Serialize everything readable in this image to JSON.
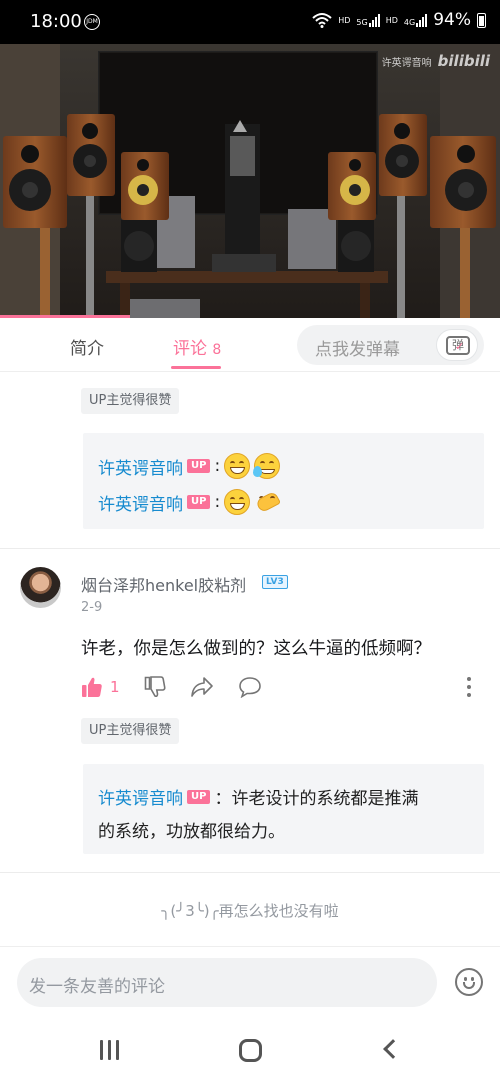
{
  "status_bar": {
    "time": "18:00",
    "notif_icon_label": "JDM",
    "hd1": "HD",
    "net5g": "5G",
    "hd2": "HD",
    "net4g": "4G",
    "battery": "94%"
  },
  "video": {
    "watermark_user": "许英谔音响",
    "watermark_logo": "bilibili",
    "progress_fraction": 0.26
  },
  "tabs": {
    "intro_label": "简介",
    "comments_label": "评论",
    "comments_count": "8",
    "danmaku_placeholder": "点我发弹幕",
    "danmaku_button_label": "弹"
  },
  "comments": [
    {
      "liked_tag": "UP主觉得很赞",
      "replies": [
        {
          "name": "许英谔音响",
          "badge": "UP",
          "sep": ":",
          "emojis": [
            "grin-emoji",
            "cry-emoji"
          ]
        },
        {
          "name": "许英谔音响",
          "badge": "UP",
          "sep": ":",
          "emojis": [
            "grin-emoji",
            "ok-hand-emoji"
          ]
        }
      ]
    },
    {
      "username": "烟台泽邦henkel胶粘剂",
      "level": "LV3",
      "date": "2-9",
      "content": "许老，你是怎么做到的？这么牛逼的低频啊？",
      "likes": "1",
      "liked_tag": "UP主觉得很赞",
      "reply": {
        "name": "许英谔音响",
        "badge": "UP",
        "text_line1": "：许老设计的系统都是推满",
        "text_line2": "的系统，功放都很给力。"
      }
    }
  ],
  "end_tip": "╮(╯3╰)╭再怎么找也没有啦",
  "comment_bar": {
    "placeholder": "发一条友善的评论"
  }
}
